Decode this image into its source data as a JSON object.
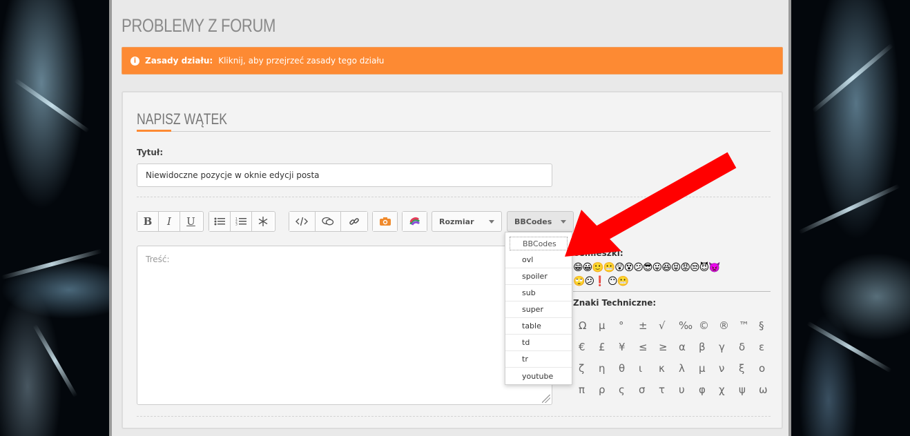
{
  "forum": {
    "title": "PROBLEMY Z FORUM"
  },
  "rules": {
    "label": "Zasady działu:",
    "text": "Kliknij, aby przejrzeć zasady tego działu",
    "color": "#fd8a33"
  },
  "compose": {
    "heading": "NAPISZ WĄTEK",
    "title_label": "Tytuł:",
    "title_value": "Niewidoczne pozycje w oknie edycji posta",
    "body_placeholder": "Treść:"
  },
  "toolbar": {
    "bold": "B",
    "italic": "I",
    "underline": "U",
    "icons": [
      "list-bullet-icon",
      "list-numbered-icon",
      "asterisk-icon",
      "code-icon",
      "quote-icon",
      "link-icon",
      "camera-icon",
      "color-icon"
    ],
    "size_select": "Rozmiar",
    "bbcodes_select": "BBCodes"
  },
  "bbcodes_dropdown": {
    "items": [
      "BBCodes",
      "ovl",
      "spoiler",
      "sub",
      "super",
      "table",
      "td",
      "tr",
      "youtube"
    ]
  },
  "smileys": {
    "label": "Uśmieszki:"
  },
  "technical_chars": {
    "label": "Znaki Techniczne:",
    "chars": [
      "Ω",
      "μ",
      "°",
      "±",
      "√",
      "‰",
      "©",
      "®",
      "™",
      "§",
      "€",
      "£",
      "¥",
      "≤",
      "≥",
      "α",
      "β",
      "γ",
      "δ",
      "ε",
      "ζ",
      "η",
      "θ",
      "ι",
      "κ",
      "λ",
      "μ",
      "ν",
      "ξ",
      "ο",
      "π",
      "ρ",
      "ς",
      "σ",
      "τ",
      "υ",
      "φ",
      "χ",
      "ψ",
      "ω"
    ]
  },
  "annotation": {
    "arrow_color": "#ff0000"
  }
}
